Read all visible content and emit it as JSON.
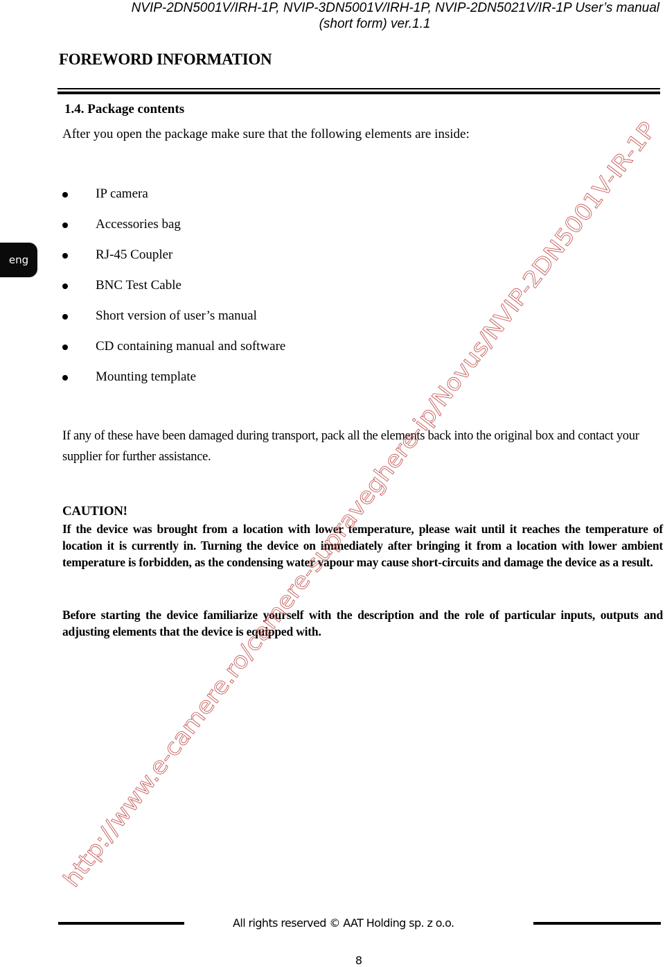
{
  "header": {
    "line1": "NVIP-2DN5001V/IRH-1P, NVIP-3DN5001V/IRH-1P, NVIP-2DN5021V/IR-1P User’s manual",
    "line2": "(short form) ver.1.1"
  },
  "section_heading": "FOREWORD INFORMATION",
  "language_tab": "eng",
  "subsection": {
    "title": "1.4. Package contents",
    "intro": "After you open the package make sure that the following elements are inside:",
    "items": [
      "IP camera",
      "Accessories bag",
      "RJ-45 Coupler",
      "BNC Test Cable",
      "Short version of user’s manual",
      "CD containing manual and software",
      "Mounting template"
    ],
    "damage_note": "If any of these have been damaged during transport, pack all the elements back into the original box and contact your supplier for further assistance."
  },
  "caution": {
    "title": "CAUTION!",
    "text": "If the device was brought from a location with lower temperature, please wait until it reaches the temperature of location it is currently in. Turning the device on immediately after bringing it from a location with lower ambient temperature is forbidden, as the condensing water vapour may cause short-circuits and damage the device as a result.",
    "note": "Before starting the device familiarize yourself with the description and the role of particular inputs, outputs and adjusting elements that the device is equipped with."
  },
  "watermark": {
    "text": "http://www.e-camere.ro/camere-supraveghere-ip/Novus/NVIP-2DN5001V-IR-1P",
    "color": "#c0504d"
  },
  "footer": {
    "copyright": "All rights reserved © AAT Holding sp. z o.o.",
    "page_number": "8"
  }
}
